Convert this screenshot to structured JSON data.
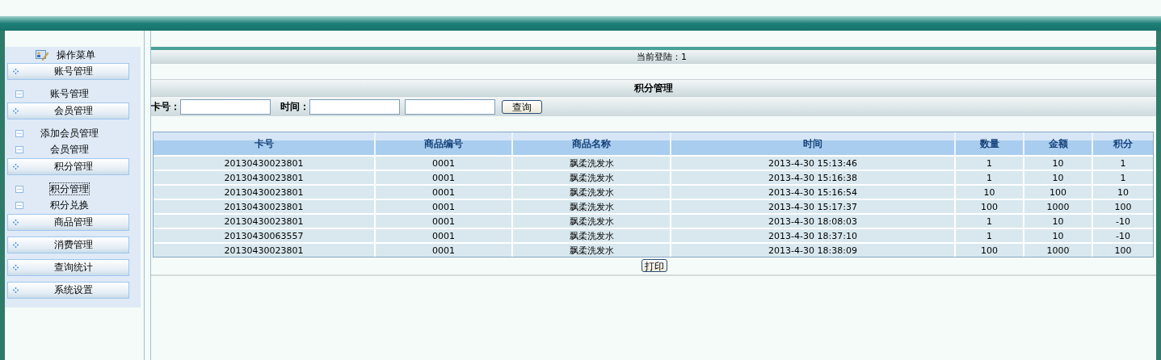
{
  "sidebar": {
    "title": "操作菜单",
    "groups": [
      {
        "label": "账号管理",
        "items": [
          {
            "label": "账号管理",
            "selected": false
          }
        ]
      },
      {
        "label": "会员管理",
        "items": [
          {
            "label": "添加会员管理",
            "selected": false
          },
          {
            "label": "会员管理",
            "selected": false
          }
        ]
      },
      {
        "label": "积分管理",
        "items": [
          {
            "label": "积分管理",
            "selected": true
          },
          {
            "label": "积分兑换",
            "selected": false
          }
        ]
      },
      {
        "label": "商品管理"
      },
      {
        "label": "消费管理"
      },
      {
        "label": "查询统计"
      },
      {
        "label": "系统设置"
      }
    ]
  },
  "login_bar": "当前登陆：1",
  "page_title": "积分管理",
  "search": {
    "card_label": "卡号：",
    "time_label": "时间：",
    "button": "查询"
  },
  "table": {
    "columns": [
      "卡号",
      "商品编号",
      "商品名称",
      "时间",
      "数量",
      "金额",
      "积分"
    ],
    "rows": [
      [
        "20130430023801",
        "0001",
        "飘柔洗发水",
        "2013-4-30 15:13:46",
        "1",
        "10",
        "1"
      ],
      [
        "20130430023801",
        "0001",
        "飘柔洗发水",
        "2013-4-30 15:16:38",
        "1",
        "10",
        "1"
      ],
      [
        "20130430023801",
        "0001",
        "飘柔洗发水",
        "2013-4-30 15:16:54",
        "10",
        "100",
        "10"
      ],
      [
        "20130430023801",
        "0001",
        "飘柔洗发水",
        "2013-4-30 15:17:37",
        "100",
        "1000",
        "100"
      ],
      [
        "20130430023801",
        "0001",
        "飘柔洗发水",
        "2013-4-30 18:08:03",
        "1",
        "10",
        "-10"
      ],
      [
        "20130430063557",
        "0001",
        "飘柔洗发水",
        "2013-4-30 18:37:10",
        "1",
        "10",
        "-10"
      ],
      [
        "20130430023801",
        "0001",
        "飘柔洗发水",
        "2013-4-30 18:38:09",
        "100",
        "1000",
        "100"
      ]
    ]
  },
  "print_button": "打印"
}
